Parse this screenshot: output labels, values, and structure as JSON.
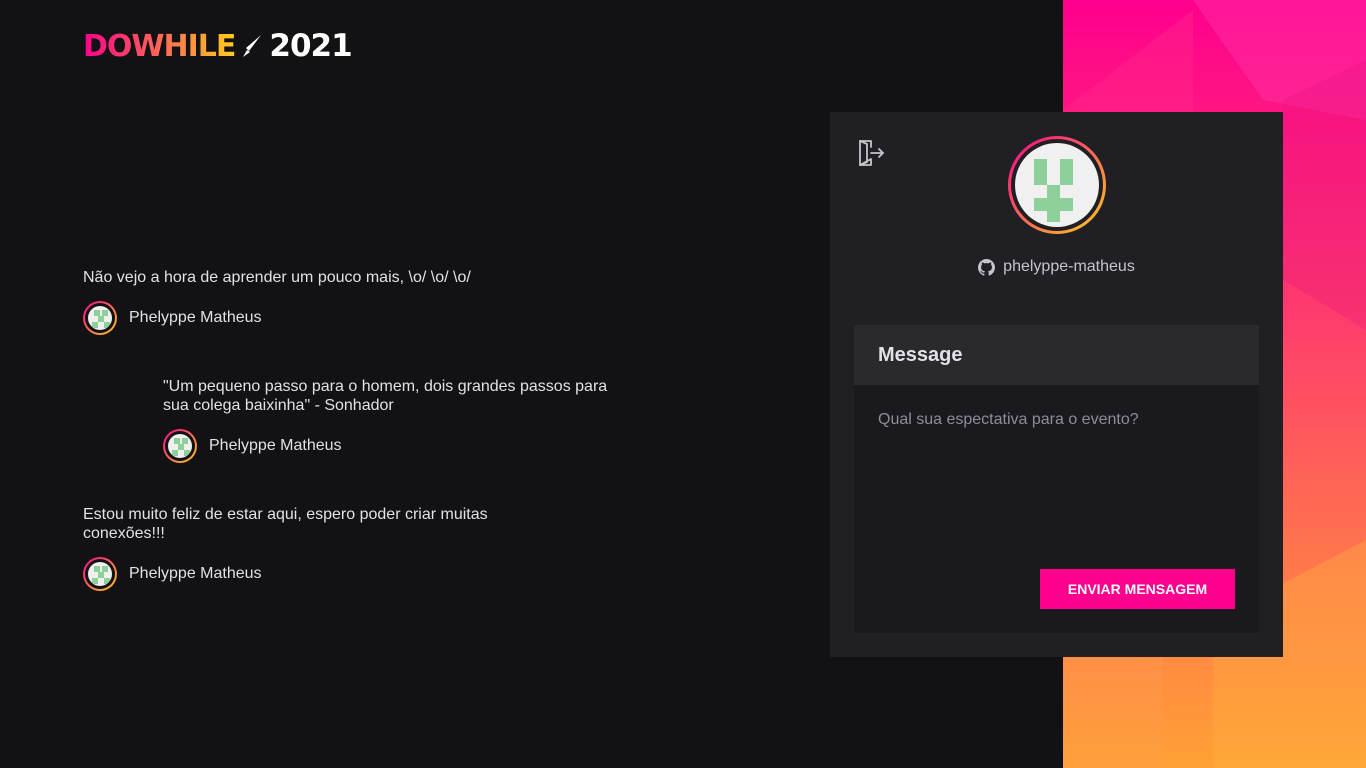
{
  "brand": {
    "name": "DOWHILE",
    "year": "2021",
    "accent": "#ff008e"
  },
  "messages": [
    {
      "text": "Não vejo a hora de aprender um pouco mais, \\o/ \\o/ \\o/",
      "user": "Phelyppe Matheus"
    },
    {
      "text": "\"Um pequeno passo para o homem, dois grandes passos para sua colega baixinha\" - Sonhador",
      "user": "Phelyppe Matheus"
    },
    {
      "text": "Estou muito feliz de estar aqui, espero poder criar muitas conexões!!!",
      "user": "Phelyppe Matheus"
    }
  ],
  "profile": {
    "login": "phelyppe-matheus",
    "icons": [
      "signout-icon",
      "github-icon"
    ]
  },
  "form": {
    "title": "Message",
    "placeholder": "Qual sua espectativa para o evento?",
    "submit_label": "ENVIAR MENSAGEM"
  }
}
